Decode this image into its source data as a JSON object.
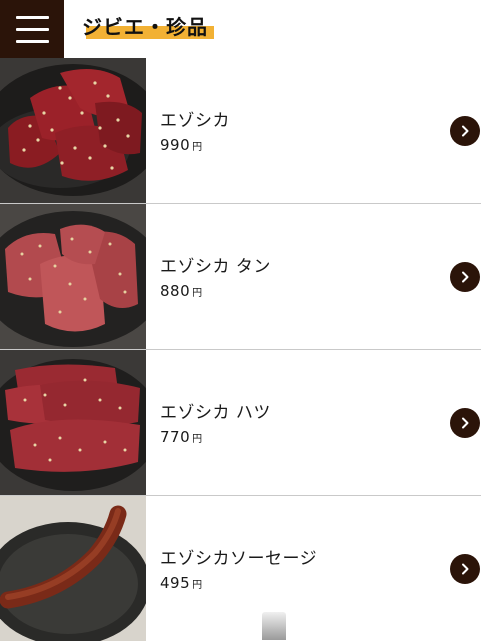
{
  "header": {
    "title": "ジビエ・珍品"
  },
  "items": [
    {
      "name": "エゾシカ",
      "price": "990",
      "unit": "円"
    },
    {
      "name": "エゾシカ タン",
      "price": "880",
      "unit": "円"
    },
    {
      "name": "エゾシカ ハツ",
      "price": "770",
      "unit": "円"
    },
    {
      "name": "エゾシカソーセージ",
      "price": "495",
      "unit": "円"
    }
  ],
  "colors": {
    "accent_dark": "#2b1409",
    "highlight": "#f2b134",
    "divider": "#c9c9c9"
  }
}
